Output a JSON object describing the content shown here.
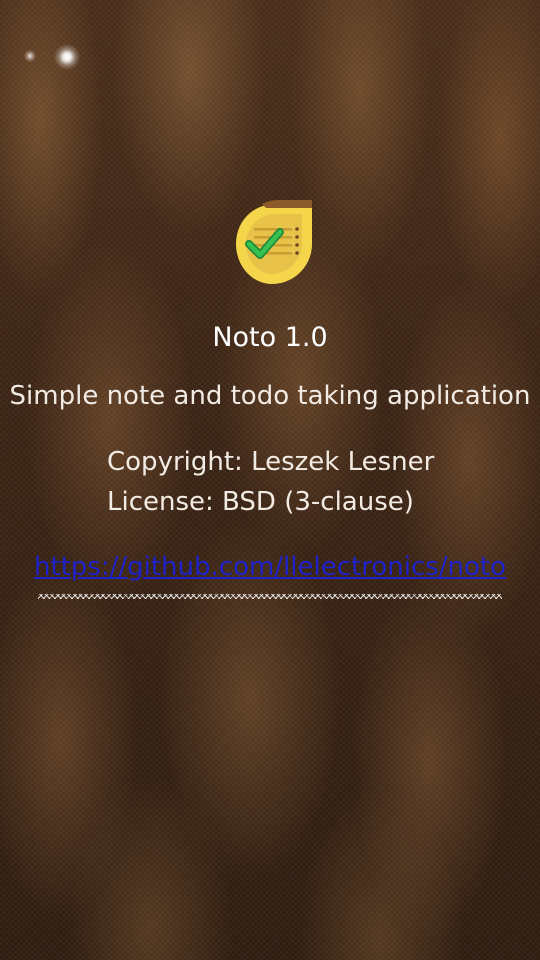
{
  "app": {
    "name": "Noto 1.0",
    "description": "Simple note and todo taking application",
    "copyright": "Copyright: Leszek Lesner",
    "license": "License: BSD (3-clause)",
    "link": "https://github.com/llelectronics/noto"
  },
  "icons": {
    "app_icon": "noto-app-icon",
    "status_indicator": "notification-dot-icon"
  },
  "colors": {
    "link": "#1f22c8",
    "text": "#f2ebe4",
    "title": "#ffffff",
    "icon_yellow": "#f5d64a",
    "icon_check": "#2ea84a",
    "icon_brown": "#8a5a2a"
  }
}
